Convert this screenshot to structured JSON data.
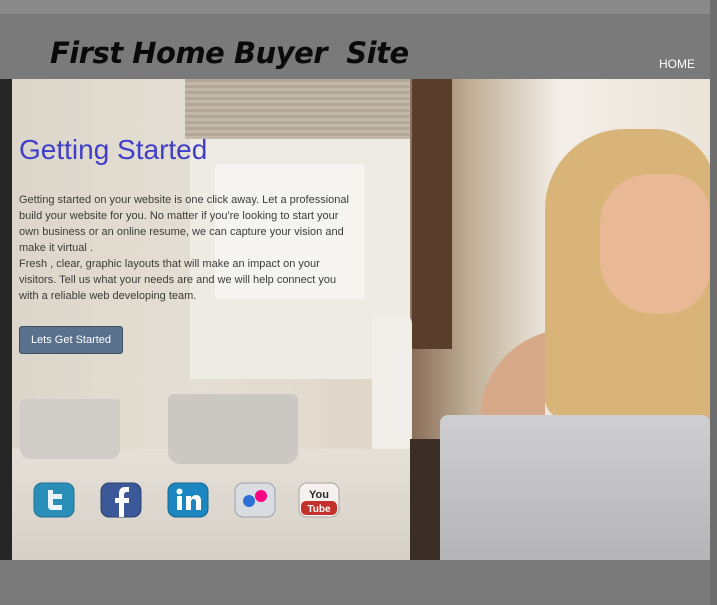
{
  "header": {
    "site_title": "First Home Buyer  Site",
    "nav": [
      {
        "label": "HOME"
      }
    ]
  },
  "hero": {
    "heading": "Getting Started",
    "paragraphs": [
      "Getting started on your website is one click away. Let a professional build your website for you. No matter if you're looking to start your own business or an online resume, we can capture your vision and make it virtual .",
      "Fresh , clear, graphic layouts that will make an impact on your visitors. Tell us what your needs are and we will help connect you with a reliable web developing team."
    ],
    "cta_label": "Lets Get Started"
  },
  "social": [
    {
      "icon": "twitter-icon",
      "color": "#2a8fb8"
    },
    {
      "icon": "facebook-icon",
      "color": "#3b5998"
    },
    {
      "icon": "linkedin-icon",
      "color": "#1b86bf"
    },
    {
      "icon": "flickr-icon",
      "color": "#ff0084"
    },
    {
      "icon": "youtube-icon",
      "color": "#c4302b",
      "text_top": "You",
      "text_bottom": "Tube"
    }
  ],
  "colors": {
    "accent_heading": "#3f3fc8",
    "button": "#59718c",
    "frame": "#7a7a7a"
  }
}
